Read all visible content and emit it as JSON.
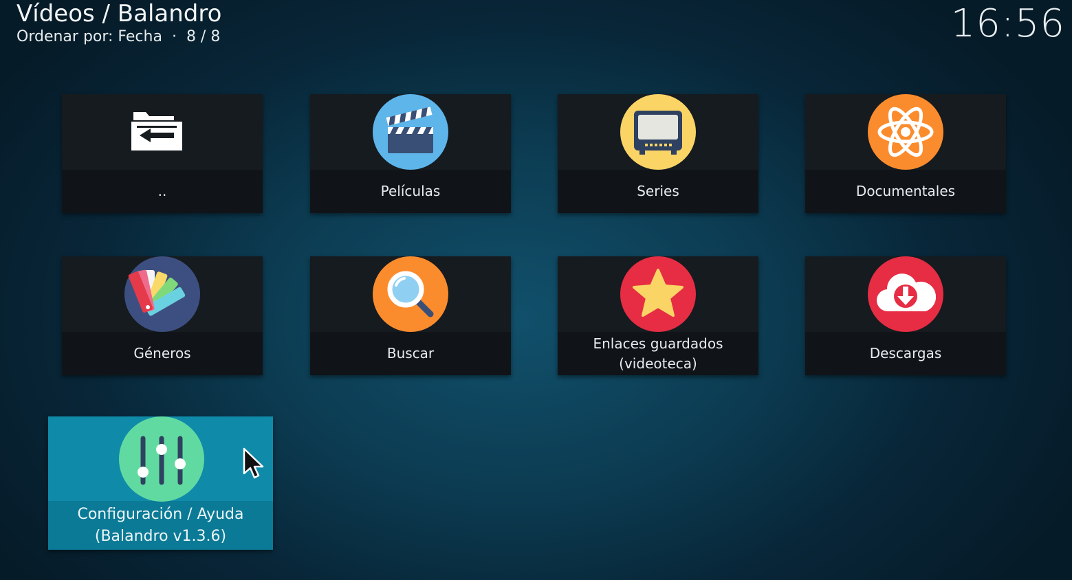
{
  "header": {
    "title": "Vídeos / Balandro",
    "sort_label": "Ordenar por: Fecha",
    "separator": "·",
    "count": "8 / 8"
  },
  "clock": "16:56",
  "tiles": [
    {
      "label": "..",
      "icon": "folder-back-icon"
    },
    {
      "label": "Películas",
      "icon": "clapperboard-icon",
      "color": "#5db5ea"
    },
    {
      "label": "Series",
      "icon": "tv-icon",
      "color": "#fbd466"
    },
    {
      "label": "Documentales",
      "icon": "atom-icon",
      "color": "#fb8c2d"
    },
    {
      "label": "Géneros",
      "icon": "color-palette-icon",
      "color": "#3d4f80"
    },
    {
      "label": "Buscar",
      "icon": "magnifier-icon",
      "color": "#fb8c2d"
    },
    {
      "label": "Enlaces guardados\n(videoteca)",
      "icon": "star-icon",
      "color": "#e62d43"
    },
    {
      "label": "Descargas",
      "icon": "cloud-download-icon",
      "color": "#e62d43"
    },
    {
      "label": "Configuración / Ayuda\n(Balandro v1.3.6)",
      "icon": "sliders-icon",
      "color": "#61daa1",
      "focused": true
    }
  ],
  "colors": {
    "focus": "#108aa9",
    "tile_bg": "#161b20"
  }
}
